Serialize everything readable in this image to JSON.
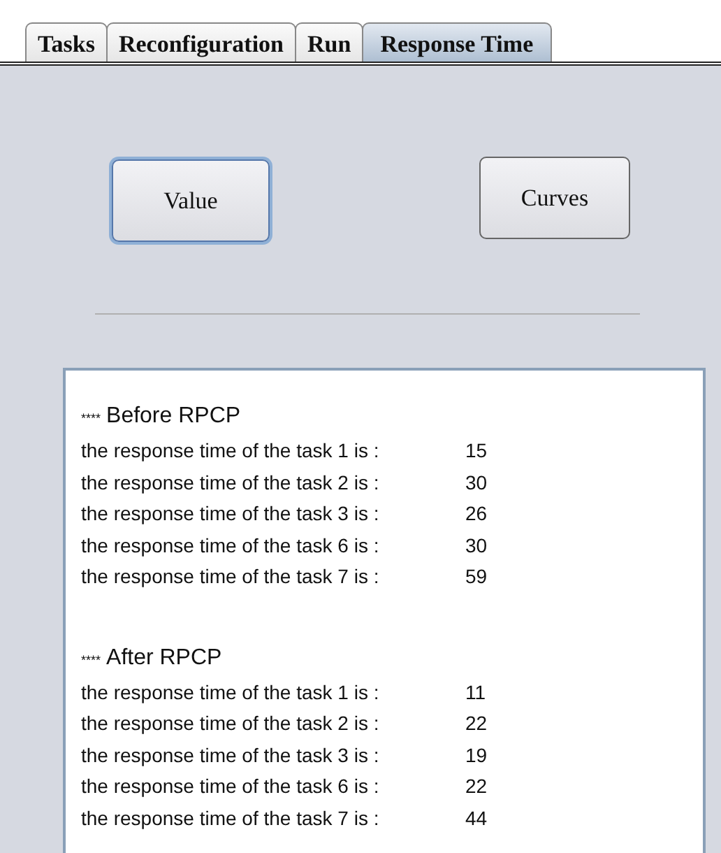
{
  "tabs": [
    {
      "label": "Tasks",
      "selected": false
    },
    {
      "label": "Reconfiguration",
      "selected": false
    },
    {
      "label": "Run",
      "selected": false
    },
    {
      "label": "Response Time",
      "selected": true
    }
  ],
  "buttons": [
    {
      "label": "Value",
      "focused": true
    },
    {
      "label": "Curves",
      "focused": false
    }
  ],
  "output": {
    "sections": [
      {
        "marker": "****",
        "title": "Before RPCP",
        "lines": [
          {
            "label": "the response time of the task 1 is :",
            "value": "15"
          },
          {
            "label": "the response time of the task 2 is :",
            "value": "30"
          },
          {
            "label": "the response time of the task 3 is :",
            "value": "26"
          },
          {
            "label": "the response time of the task 6 is :",
            "value": "30"
          },
          {
            "label": "the response time of the task 7 is :",
            "value": "59"
          }
        ]
      },
      {
        "marker": "****",
        "title": "After RPCP",
        "lines": [
          {
            "label": "the response time of the task 1 is :",
            "value": "11"
          },
          {
            "label": "the response time of the task 2 is :",
            "value": "22"
          },
          {
            "label": "the response time of the task 3 is :",
            "value": "19"
          },
          {
            "label": "the response time of the task 6 is :",
            "value": "22"
          },
          {
            "label": "the response time of the task 7 is :",
            "value": "44"
          }
        ]
      }
    ]
  }
}
